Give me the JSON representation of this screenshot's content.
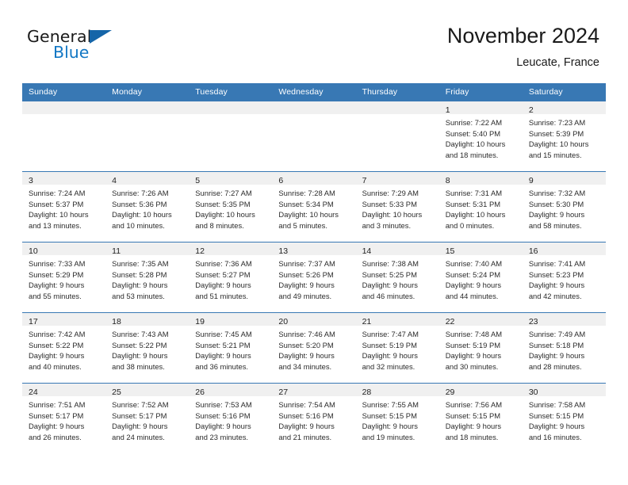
{
  "brand": {
    "name_part1": "General",
    "name_part2": "Blue",
    "accent_color": "#1277c4",
    "triangle_color": "#1565a8"
  },
  "header": {
    "title": "November 2024",
    "subtitle": "Leucate, France"
  },
  "calendar": {
    "header_bg": "#3878b4",
    "day_band_bg": "#f0f0f0",
    "weekdays": [
      "Sunday",
      "Monday",
      "Tuesday",
      "Wednesday",
      "Thursday",
      "Friday",
      "Saturday"
    ],
    "weeks": [
      [
        {
          "day": "",
          "lines": []
        },
        {
          "day": "",
          "lines": []
        },
        {
          "day": "",
          "lines": []
        },
        {
          "day": "",
          "lines": []
        },
        {
          "day": "",
          "lines": []
        },
        {
          "day": "1",
          "lines": [
            "Sunrise: 7:22 AM",
            "Sunset: 5:40 PM",
            "Daylight: 10 hours",
            "and 18 minutes."
          ]
        },
        {
          "day": "2",
          "lines": [
            "Sunrise: 7:23 AM",
            "Sunset: 5:39 PM",
            "Daylight: 10 hours",
            "and 15 minutes."
          ]
        }
      ],
      [
        {
          "day": "3",
          "lines": [
            "Sunrise: 7:24 AM",
            "Sunset: 5:37 PM",
            "Daylight: 10 hours",
            "and 13 minutes."
          ]
        },
        {
          "day": "4",
          "lines": [
            "Sunrise: 7:26 AM",
            "Sunset: 5:36 PM",
            "Daylight: 10 hours",
            "and 10 minutes."
          ]
        },
        {
          "day": "5",
          "lines": [
            "Sunrise: 7:27 AM",
            "Sunset: 5:35 PM",
            "Daylight: 10 hours",
            "and 8 minutes."
          ]
        },
        {
          "day": "6",
          "lines": [
            "Sunrise: 7:28 AM",
            "Sunset: 5:34 PM",
            "Daylight: 10 hours",
            "and 5 minutes."
          ]
        },
        {
          "day": "7",
          "lines": [
            "Sunrise: 7:29 AM",
            "Sunset: 5:33 PM",
            "Daylight: 10 hours",
            "and 3 minutes."
          ]
        },
        {
          "day": "8",
          "lines": [
            "Sunrise: 7:31 AM",
            "Sunset: 5:31 PM",
            "Daylight: 10 hours",
            "and 0 minutes."
          ]
        },
        {
          "day": "9",
          "lines": [
            "Sunrise: 7:32 AM",
            "Sunset: 5:30 PM",
            "Daylight: 9 hours",
            "and 58 minutes."
          ]
        }
      ],
      [
        {
          "day": "10",
          "lines": [
            "Sunrise: 7:33 AM",
            "Sunset: 5:29 PM",
            "Daylight: 9 hours",
            "and 55 minutes."
          ]
        },
        {
          "day": "11",
          "lines": [
            "Sunrise: 7:35 AM",
            "Sunset: 5:28 PM",
            "Daylight: 9 hours",
            "and 53 minutes."
          ]
        },
        {
          "day": "12",
          "lines": [
            "Sunrise: 7:36 AM",
            "Sunset: 5:27 PM",
            "Daylight: 9 hours",
            "and 51 minutes."
          ]
        },
        {
          "day": "13",
          "lines": [
            "Sunrise: 7:37 AM",
            "Sunset: 5:26 PM",
            "Daylight: 9 hours",
            "and 49 minutes."
          ]
        },
        {
          "day": "14",
          "lines": [
            "Sunrise: 7:38 AM",
            "Sunset: 5:25 PM",
            "Daylight: 9 hours",
            "and 46 minutes."
          ]
        },
        {
          "day": "15",
          "lines": [
            "Sunrise: 7:40 AM",
            "Sunset: 5:24 PM",
            "Daylight: 9 hours",
            "and 44 minutes."
          ]
        },
        {
          "day": "16",
          "lines": [
            "Sunrise: 7:41 AM",
            "Sunset: 5:23 PM",
            "Daylight: 9 hours",
            "and 42 minutes."
          ]
        }
      ],
      [
        {
          "day": "17",
          "lines": [
            "Sunrise: 7:42 AM",
            "Sunset: 5:22 PM",
            "Daylight: 9 hours",
            "and 40 minutes."
          ]
        },
        {
          "day": "18",
          "lines": [
            "Sunrise: 7:43 AM",
            "Sunset: 5:22 PM",
            "Daylight: 9 hours",
            "and 38 minutes."
          ]
        },
        {
          "day": "19",
          "lines": [
            "Sunrise: 7:45 AM",
            "Sunset: 5:21 PM",
            "Daylight: 9 hours",
            "and 36 minutes."
          ]
        },
        {
          "day": "20",
          "lines": [
            "Sunrise: 7:46 AM",
            "Sunset: 5:20 PM",
            "Daylight: 9 hours",
            "and 34 minutes."
          ]
        },
        {
          "day": "21",
          "lines": [
            "Sunrise: 7:47 AM",
            "Sunset: 5:19 PM",
            "Daylight: 9 hours",
            "and 32 minutes."
          ]
        },
        {
          "day": "22",
          "lines": [
            "Sunrise: 7:48 AM",
            "Sunset: 5:19 PM",
            "Daylight: 9 hours",
            "and 30 minutes."
          ]
        },
        {
          "day": "23",
          "lines": [
            "Sunrise: 7:49 AM",
            "Sunset: 5:18 PM",
            "Daylight: 9 hours",
            "and 28 minutes."
          ]
        }
      ],
      [
        {
          "day": "24",
          "lines": [
            "Sunrise: 7:51 AM",
            "Sunset: 5:17 PM",
            "Daylight: 9 hours",
            "and 26 minutes."
          ]
        },
        {
          "day": "25",
          "lines": [
            "Sunrise: 7:52 AM",
            "Sunset: 5:17 PM",
            "Daylight: 9 hours",
            "and 24 minutes."
          ]
        },
        {
          "day": "26",
          "lines": [
            "Sunrise: 7:53 AM",
            "Sunset: 5:16 PM",
            "Daylight: 9 hours",
            "and 23 minutes."
          ]
        },
        {
          "day": "27",
          "lines": [
            "Sunrise: 7:54 AM",
            "Sunset: 5:16 PM",
            "Daylight: 9 hours",
            "and 21 minutes."
          ]
        },
        {
          "day": "28",
          "lines": [
            "Sunrise: 7:55 AM",
            "Sunset: 5:15 PM",
            "Daylight: 9 hours",
            "and 19 minutes."
          ]
        },
        {
          "day": "29",
          "lines": [
            "Sunrise: 7:56 AM",
            "Sunset: 5:15 PM",
            "Daylight: 9 hours",
            "and 18 minutes."
          ]
        },
        {
          "day": "30",
          "lines": [
            "Sunrise: 7:58 AM",
            "Sunset: 5:15 PM",
            "Daylight: 9 hours",
            "and 16 minutes."
          ]
        }
      ]
    ]
  }
}
